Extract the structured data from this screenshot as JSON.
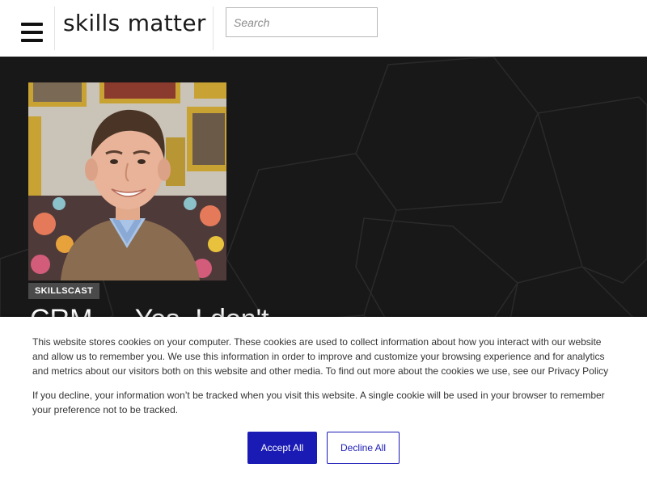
{
  "header": {
    "logo_text": "skills matter",
    "search_placeholder": "Search",
    "menu_icon": "hamburger-menu-icon"
  },
  "hero": {
    "tag": "SKILLSCAST",
    "title": "CRM — Yes, I don't",
    "photo_description_icon": "speaker-photo"
  },
  "cookie_banner": {
    "paragraph_1": "This website stores cookies on your computer. These cookies are used to collect information about how you interact with our website and allow us to remember you. We use this information in order to improve and customize your browsing experience and for analytics and metrics about our visitors both on this website and other media. To find out more about the cookies we use, see our Privacy Policy",
    "paragraph_2": "If you decline, your information won’t be tracked when you visit this website. A single cookie will be used in your browser to remember your preference not to be tracked.",
    "accept_label": "Accept All",
    "decline_label": "Decline All"
  },
  "colors": {
    "accent": "#1a1ab5",
    "hero_bg": "#191818",
    "tag_bg": "#4a4a4a"
  }
}
